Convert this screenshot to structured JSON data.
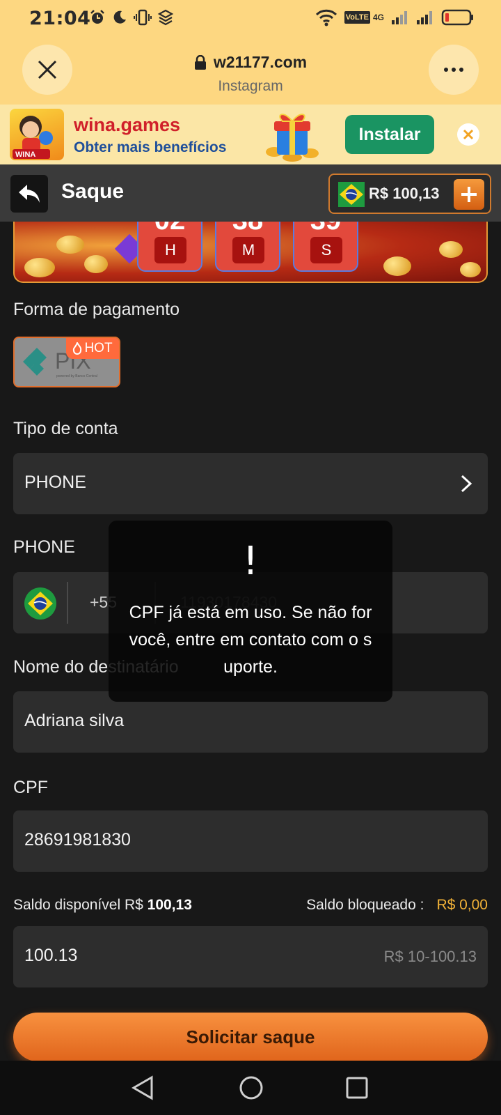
{
  "status_bar": {
    "time": "21:04",
    "volte": "VoLTE",
    "network": "4G"
  },
  "browser": {
    "url": "w21177.com",
    "source": "Instagram"
  },
  "banner": {
    "title": "wina.games",
    "subtitle": "Obter mais benefícios",
    "install_label": "Instalar",
    "logo_text": "WINA"
  },
  "header": {
    "title": "Saque",
    "balance": "R$ 100,13"
  },
  "promo": {
    "timer": [
      {
        "digit": "02",
        "unit": "H"
      },
      {
        "digit": "38",
        "unit": "M"
      },
      {
        "digit": "39",
        "unit": "S"
      }
    ]
  },
  "payment": {
    "label": "Forma de pagamento",
    "method": "PIX",
    "badge": "HOT",
    "powered": "powered by Banco Central"
  },
  "account_type": {
    "label": "Tipo de conta",
    "value": "PHONE"
  },
  "phone": {
    "label": "PHONE",
    "country_code": "+55",
    "number": "11930178430"
  },
  "recipient": {
    "label": "Nome do destinatário",
    "value": "Adriana silva"
  },
  "cpf": {
    "label": "CPF",
    "value": "28691981830"
  },
  "saldo": {
    "available_label": "Saldo disponível R$",
    "available_value": "100,13",
    "blocked_label": "Saldo bloqueado :",
    "blocked_value": "R$ 0,00"
  },
  "amount": {
    "value": "100.13",
    "range": "R$ 10-100.13"
  },
  "submit_label": "Solicitar saque",
  "toast": {
    "icon": "!",
    "message": "CPF já está em uso. Se não for você, entre em contato com o suporte."
  },
  "colors": {
    "accent": "#e0651c",
    "browser_bar": "#fdd781",
    "install": "#1a9462",
    "gold": "#f2b237"
  }
}
